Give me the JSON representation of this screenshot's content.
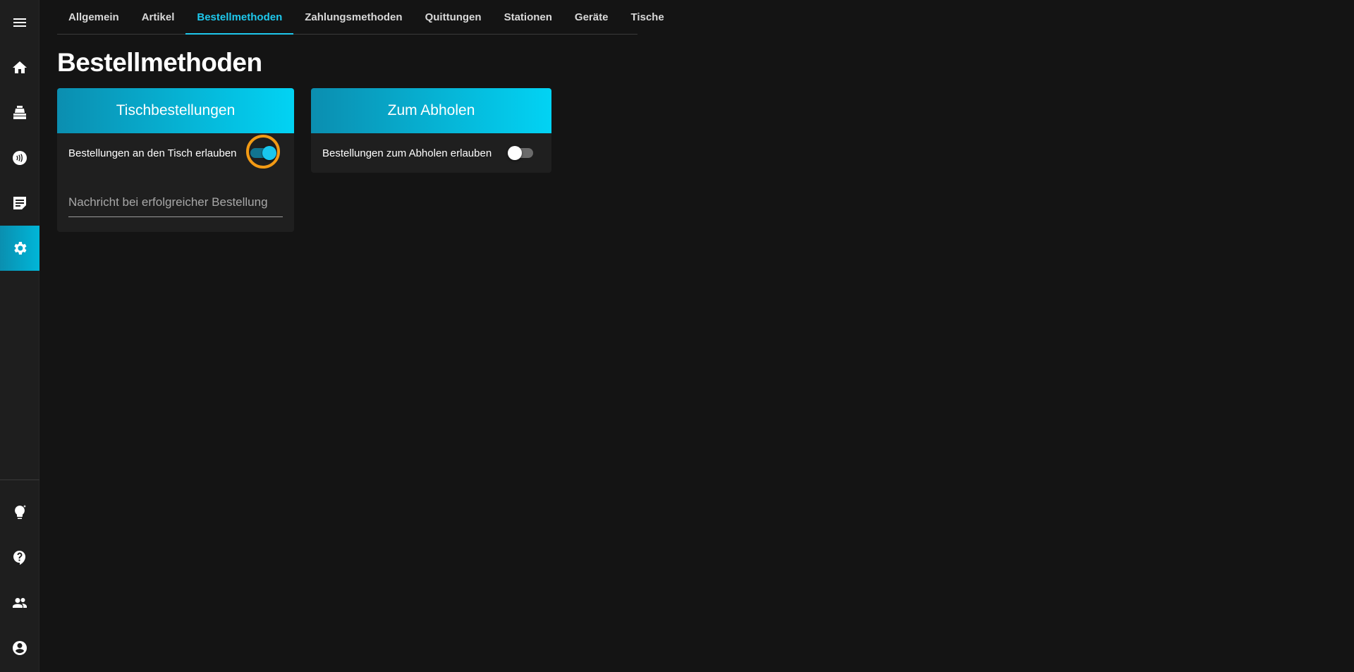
{
  "sidebar": {
    "items": [
      {
        "name": "menu-icon"
      },
      {
        "name": "home-icon"
      },
      {
        "name": "cash-register-icon"
      },
      {
        "name": "contactless-icon"
      },
      {
        "name": "notes-icon"
      },
      {
        "name": "settings-icon",
        "active": true
      }
    ],
    "bottom_items": [
      {
        "name": "lightbulb-icon"
      },
      {
        "name": "help-icon"
      },
      {
        "name": "users-icon"
      },
      {
        "name": "account-icon"
      }
    ]
  },
  "tabs": [
    {
      "label": "Allgemein",
      "active": false
    },
    {
      "label": "Artikel",
      "active": false
    },
    {
      "label": "Bestellmethoden",
      "active": true
    },
    {
      "label": "Zahlungsmethoden",
      "active": false
    },
    {
      "label": "Quittungen",
      "active": false
    },
    {
      "label": "Stationen",
      "active": false
    },
    {
      "label": "Geräte",
      "active": false
    },
    {
      "label": "Tische",
      "active": false
    }
  ],
  "page": {
    "title": "Bestellmethoden"
  },
  "cards": {
    "table_orders": {
      "title": "Tischbestellungen",
      "toggle_label": "Bestellungen an den Tisch erlauben",
      "toggle_on": true,
      "message_placeholder": "Nachricht bei erfolgreicher Bestellung",
      "message_value": ""
    },
    "pickup": {
      "title": "Zum Abholen",
      "toggle_label": "Bestellungen zum Abholen erlauben",
      "toggle_on": false
    }
  },
  "colors": {
    "accent": "#1ec8ec",
    "header_gradient_start": "#0b8eb0",
    "header_gradient_end": "#02d3f4",
    "highlight": "#f29a14",
    "background": "#141414",
    "card": "#1f1f1f",
    "sidebar": "#1e1e1e"
  }
}
